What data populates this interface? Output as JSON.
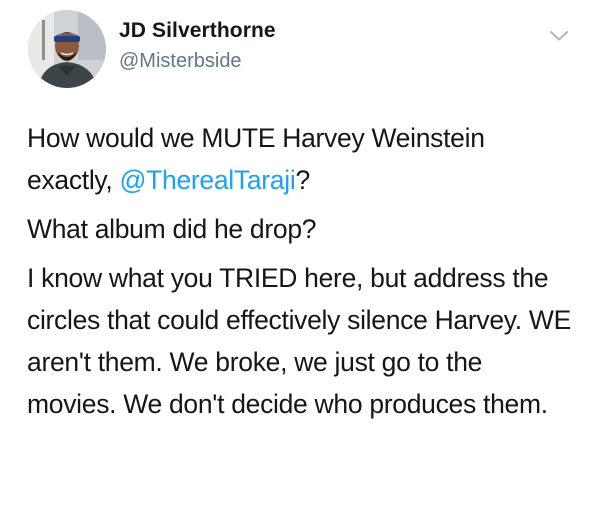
{
  "author": {
    "display_name": "JD Silverthorne",
    "handle": "@Misterbside",
    "avatar_icon": "profile-photo"
  },
  "menu": {
    "icon": "chevron-down-icon"
  },
  "tweet": {
    "para1": {
      "text_a": "How would we MUTE Harvey Weinstein exactly, ",
      "mention": "@TherealTaraji",
      "text_b": "?"
    },
    "para2": "What album did he drop?",
    "para3": "I know what you TRIED here, but address the circles that could effectively silence Harvey. WE aren't them. We broke, we just go to the movies. We don't decide who produces them."
  },
  "colors": {
    "text": "#14171a",
    "secondary": "#657786",
    "link": "#1da1f2",
    "background": "#ffffff"
  }
}
